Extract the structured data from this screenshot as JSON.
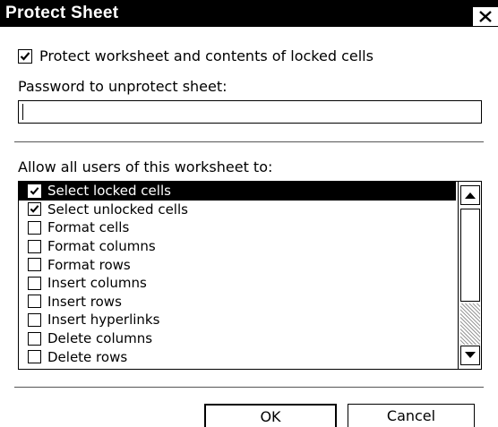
{
  "dialog": {
    "title": "Protect Sheet",
    "close_glyph": "close-icon"
  },
  "protect": {
    "label": "Protect worksheet and contents of locked cells",
    "checked": true
  },
  "password": {
    "label": "Password to unprotect sheet:",
    "value": ""
  },
  "permissions": {
    "label": "Allow all users of this worksheet to:",
    "items": [
      {
        "label": "Select locked cells",
        "checked": true,
        "selected": true
      },
      {
        "label": "Select unlocked cells",
        "checked": true,
        "selected": false
      },
      {
        "label": "Format cells",
        "checked": false,
        "selected": false
      },
      {
        "label": "Format columns",
        "checked": false,
        "selected": false
      },
      {
        "label": "Format rows",
        "checked": false,
        "selected": false
      },
      {
        "label": "Insert columns",
        "checked": false,
        "selected": false
      },
      {
        "label": "Insert rows",
        "checked": false,
        "selected": false
      },
      {
        "label": "Insert hyperlinks",
        "checked": false,
        "selected": false
      },
      {
        "label": "Delete columns",
        "checked": false,
        "selected": false
      },
      {
        "label": "Delete rows",
        "checked": false,
        "selected": false
      }
    ]
  },
  "buttons": {
    "ok": "OK",
    "cancel": "Cancel"
  },
  "colors": {
    "titlebar": "#000000",
    "selection": "#000000",
    "background": "#ffffff"
  }
}
